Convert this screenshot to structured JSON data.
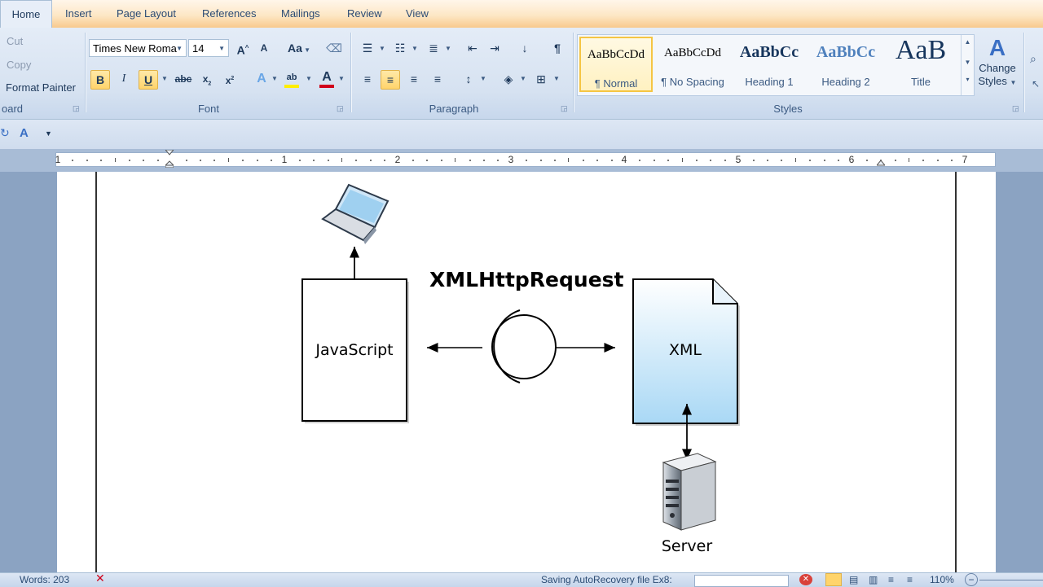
{
  "tabs": [
    {
      "label": "Home"
    },
    {
      "label": "Insert"
    },
    {
      "label": "Page Layout"
    },
    {
      "label": "References"
    },
    {
      "label": "Mailings"
    },
    {
      "label": "Review"
    },
    {
      "label": "View"
    }
  ],
  "clipboard": {
    "cut": "Cut",
    "copy": "Copy",
    "format_painter": "Format Painter",
    "group_label": "oard"
  },
  "font": {
    "name": "Times New Roma",
    "size": "14",
    "group_label": "Font",
    "grow": "A",
    "shrink": "A",
    "change_case": "Aa",
    "bold": "B",
    "italic": "I",
    "underline": "U",
    "strike": "abc",
    "sub": "x",
    "sup": "x"
  },
  "paragraph": {
    "group_label": "Paragraph",
    "pilcrow": "¶"
  },
  "styles": {
    "group_label": "Styles",
    "items": [
      {
        "preview": "AaBbCcDd",
        "name": "¶ Normal"
      },
      {
        "preview": "AaBbCcDd",
        "name": "¶ No Spacing"
      },
      {
        "preview": "AaBbCc",
        "name": "Heading 1"
      },
      {
        "preview": "AaBbCc",
        "name": "Heading 2"
      },
      {
        "preview": "AaB",
        "name": "Title"
      }
    ],
    "change_styles": [
      "Change",
      "Styles"
    ]
  },
  "ruler": {
    "numbers": [
      "1",
      "1",
      "2",
      "3",
      "4",
      "5",
      "6",
      "7"
    ]
  },
  "diagram": {
    "title": "XMLHttpRequest",
    "javascript": "JavaScript",
    "xml": "XML",
    "server": "Server"
  },
  "status": {
    "words": "Words: 203",
    "saving": "Saving AutoRecovery file Ex8:",
    "zoom": "110%"
  },
  "colors": {
    "accent_tab": "#f8c98d",
    "ribbon": "#d6e2f1",
    "xml_fill": "#a9d8f5",
    "font_color": "#d0021b",
    "highlight": "#ffee00"
  }
}
